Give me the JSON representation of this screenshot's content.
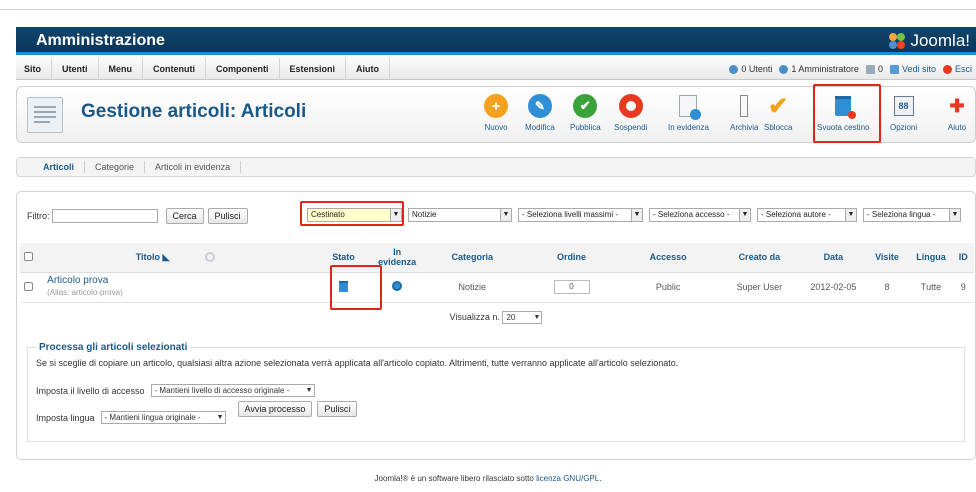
{
  "header": {
    "title": "Amministrazione",
    "logo_text": "Joomla!"
  },
  "menu": [
    "Sito",
    "Utenti",
    "Menu",
    "Contenuti",
    "Componenti",
    "Estensioni",
    "Aiuto"
  ],
  "status": {
    "users": "0 Utenti",
    "admins": "1 Amministratore",
    "messages": "0",
    "view_site": "Vedi sito",
    "logout": "Esci"
  },
  "page_title": "Gestione articoli: Articoli",
  "toolbar": [
    {
      "label": "Nuovo",
      "icon": "plus-icon",
      "color": "#f4a11d"
    },
    {
      "label": "Modifica",
      "icon": "pencil-icon",
      "color": "#2e8fd6"
    },
    {
      "label": "Pubblica",
      "icon": "check-icon",
      "color": "#3aa23a"
    },
    {
      "label": "Sospendi",
      "icon": "unpublish-icon",
      "color": "#e8381f"
    },
    {
      "label": "In evidenza",
      "icon": "featured-icon",
      "color": "#2e8fd6"
    },
    {
      "label": "Archivia",
      "icon": "archive-icon",
      "color": "#777"
    },
    {
      "label": "Sblocca",
      "icon": "checkin-icon",
      "color": "#f4a11d"
    },
    {
      "label": "Svuota cestino",
      "icon": "trash-icon",
      "color": "#2e8fd6"
    },
    {
      "label": "Opzioni",
      "icon": "options-icon",
      "color": "#2e5c8a"
    },
    {
      "label": "Aiuto",
      "icon": "help-icon",
      "color": "#e8381f"
    }
  ],
  "subnav": [
    "Articoli",
    "Categorie",
    "Articoli in evidenza"
  ],
  "filter": {
    "label": "Filtro:",
    "search_btn": "Cerca",
    "clear_btn": "Pulisci"
  },
  "selects": {
    "state": "Cestinato",
    "category": "Notizie",
    "levels": "- Seleziona livelli massimi -",
    "access": "- Seleziona accesso -",
    "author": "- Seleziona autore -",
    "language": "- Seleziona lingua -"
  },
  "table": {
    "headers": {
      "title": "Titolo",
      "state": "Stato",
      "featured_1": "In",
      "featured_2": "evidenza",
      "category": "Categoria",
      "ordering": "Ordine",
      "access": "Accesso",
      "created_by": "Creato da",
      "date": "Data",
      "hits": "Visite",
      "language": "Lingua",
      "id": "ID"
    },
    "row": {
      "title": "Articolo prova",
      "alias": "(Alias: articolo-prova)",
      "category": "Notizie",
      "ordering": "0",
      "access": "Public",
      "created_by": "Super User",
      "date": "2012-02-05",
      "hits": "8",
      "language": "Tutte",
      "id": "9"
    }
  },
  "pagination": {
    "label": "Visualizza n.",
    "value": "20"
  },
  "batch": {
    "legend": "Processa gli articoli selezionati",
    "tip": "Se si sceglie di copiare un articolo, qualsiasi altra azione selezionata verrà applicata all'articolo copiato. Altrimenti, tutte verranno applicate all'articolo selezionato.",
    "access_label": "Imposta il livello di accesso",
    "access_value": "- Mantieni livello di accesso originale -",
    "lang_label": "Imposta lingua",
    "lang_value": "- Mantieni lingua originale -",
    "run_btn": "Avvia processo",
    "clear_btn": "Pulisci"
  },
  "footer": {
    "text": "Joomla!® è un software libero rilasciato sotto ",
    "link": "licenza GNU/GPL",
    "end": "."
  }
}
